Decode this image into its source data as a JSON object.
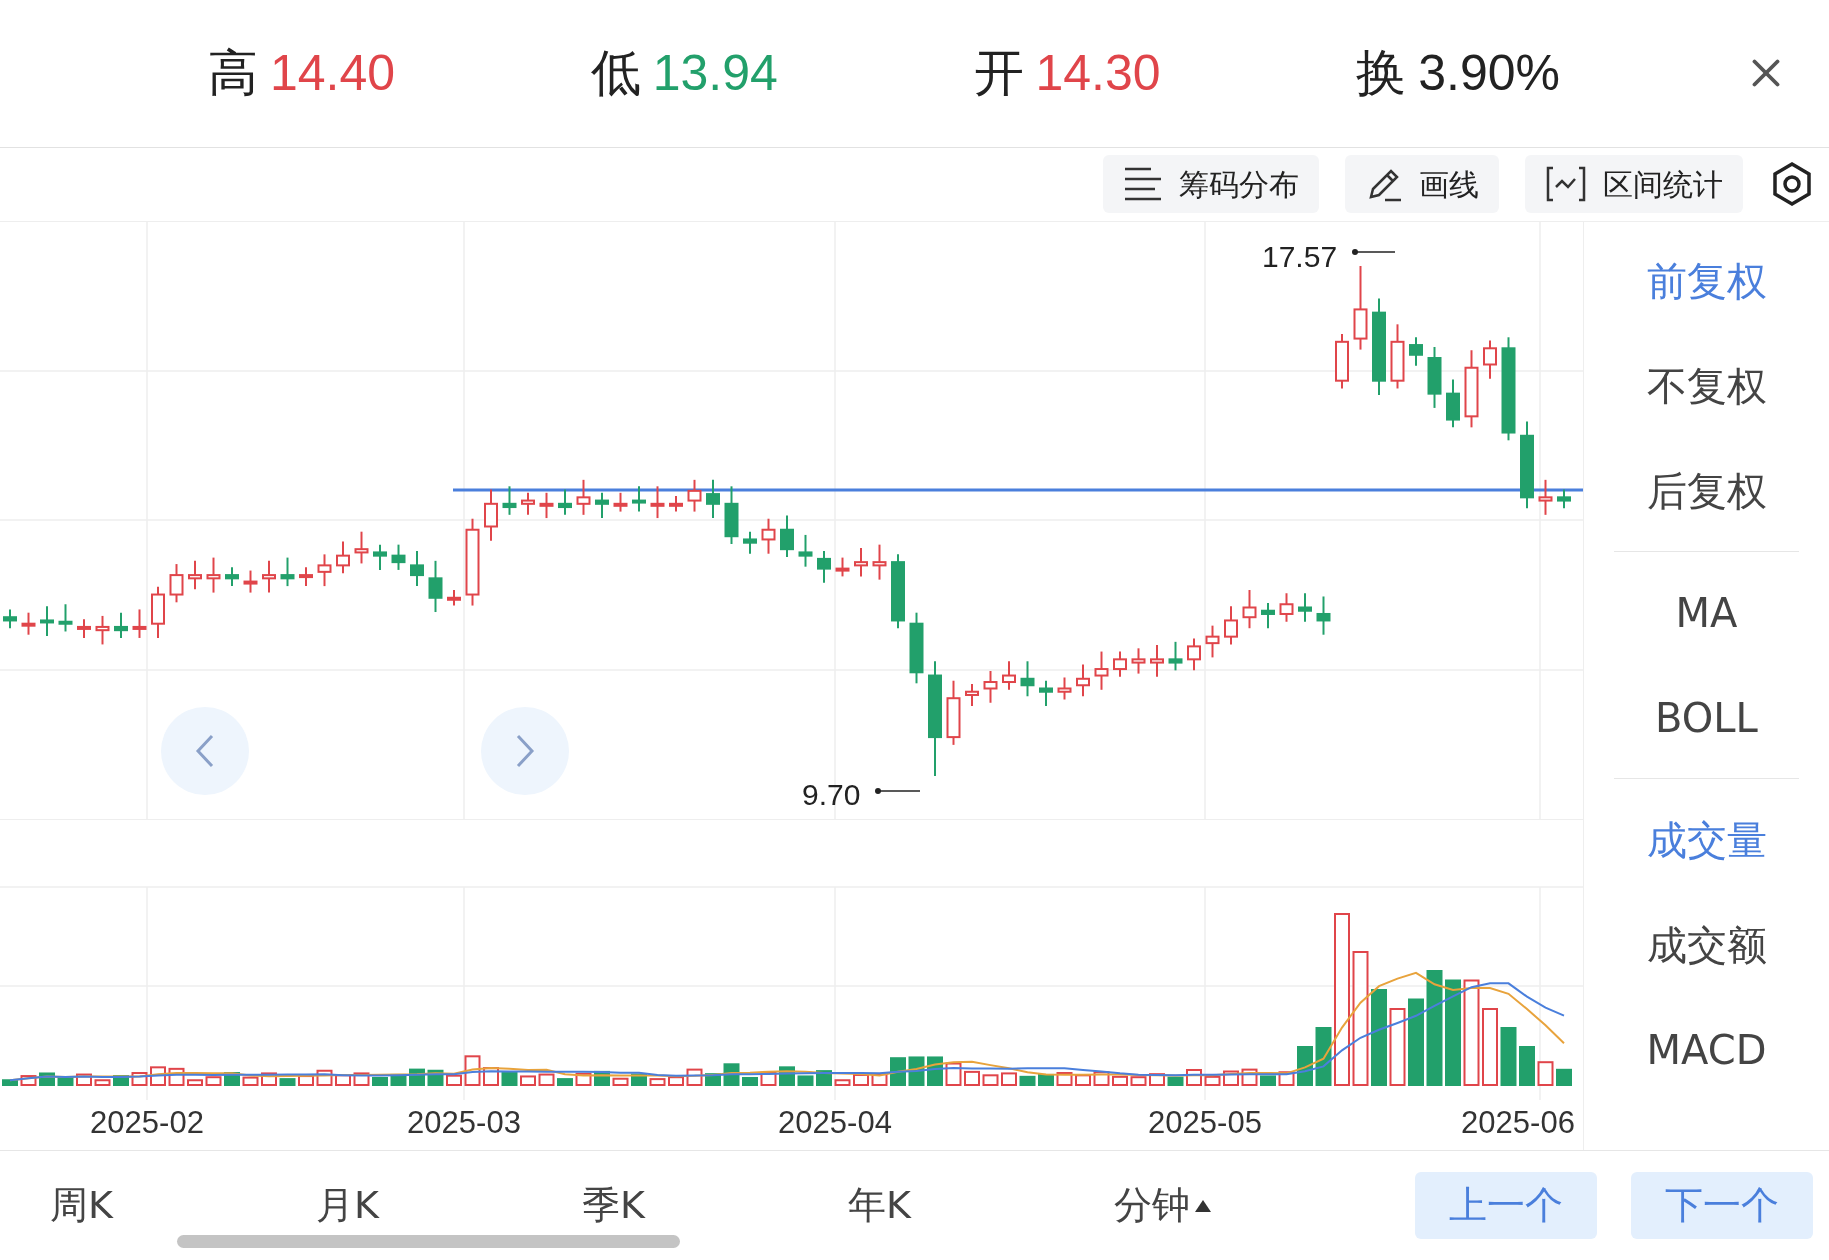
{
  "quote": [
    {
      "label": "高",
      "value": "14.40",
      "color": "#e0454a"
    },
    {
      "label": "低",
      "value": "13.94",
      "color": "#22a06b"
    },
    {
      "label": "开",
      "value": "14.30",
      "color": "#e0454a"
    },
    {
      "label": "换",
      "value": "3.90%",
      "color": "#222222"
    }
  ],
  "toolbar": [
    {
      "label": "筹码分布",
      "kind": "chips"
    },
    {
      "label": "画线",
      "kind": "draw"
    },
    {
      "label": "区间统计",
      "kind": "range"
    }
  ],
  "chart": {
    "high_marker": "17.57",
    "low_marker": "9.70",
    "dates": [
      "2025-02",
      "2025-03",
      "2025-04",
      "2025-05",
      "2025-06"
    ]
  },
  "side_panel": [
    [
      {
        "label": "前复权",
        "selected": true
      },
      {
        "label": "不复权",
        "selected": false
      },
      {
        "label": "后复权",
        "selected": false
      }
    ],
    [
      {
        "label": "MA",
        "selected": false
      },
      {
        "label": "BOLL",
        "selected": false
      }
    ],
    [
      {
        "label": "成交量",
        "selected": true
      },
      {
        "label": "成交额",
        "selected": false
      },
      {
        "label": "MACD",
        "selected": false
      }
    ]
  ],
  "period_tabs": [
    {
      "label": "周K",
      "menu": false
    },
    {
      "label": "月K",
      "menu": false
    },
    {
      "label": "季K",
      "menu": false
    },
    {
      "label": "年K",
      "menu": false
    },
    {
      "label": "分钟",
      "menu": true
    }
  ],
  "nav_buttons": [
    "上一个",
    "下一个"
  ]
}
